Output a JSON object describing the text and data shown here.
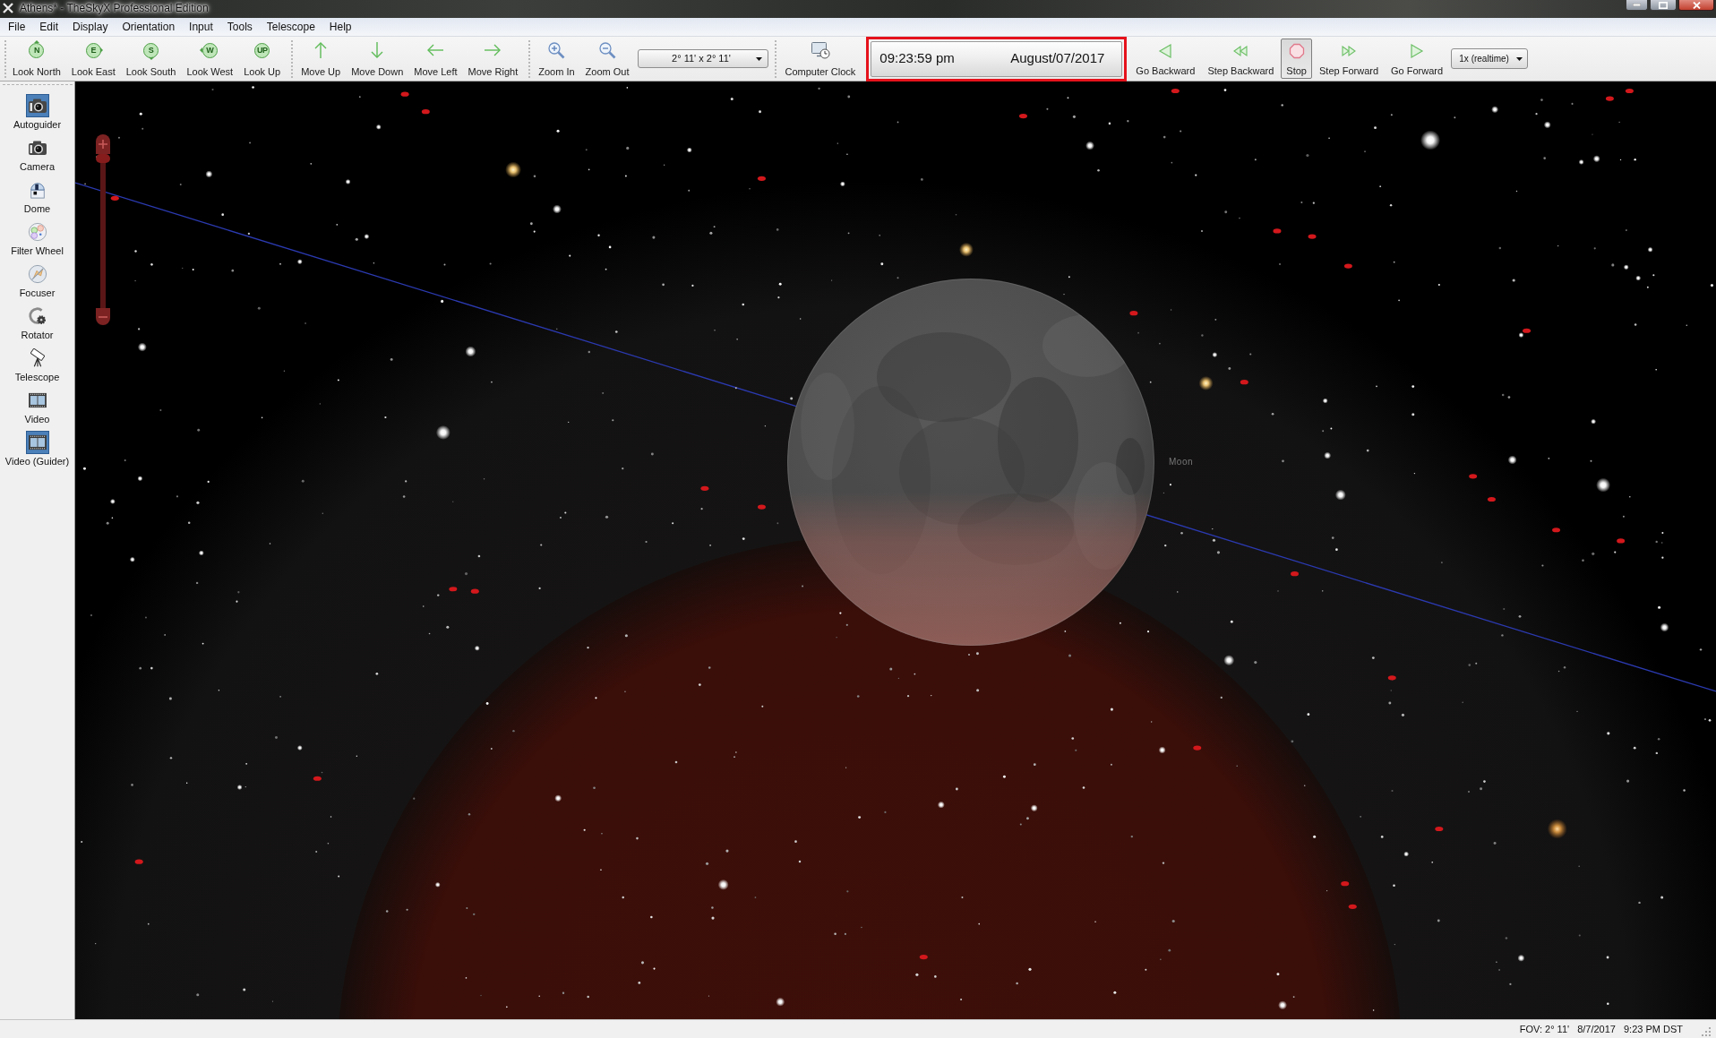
{
  "window": {
    "title": "Athens* - TheSkyX Professional Edition"
  },
  "menu_bar": [
    "File",
    "Edit",
    "Display",
    "Orientation",
    "Input",
    "Tools",
    "Telescope",
    "Help"
  ],
  "toolbar": {
    "look": [
      {
        "label": "Look North",
        "badge": "N",
        "kind": "north"
      },
      {
        "label": "Look East",
        "badge": "E",
        "kind": "east"
      },
      {
        "label": "Look South",
        "badge": "S",
        "kind": "south"
      },
      {
        "label": "Look West",
        "badge": "W",
        "kind": "west"
      },
      {
        "label": "Look Up",
        "badge": "UP",
        "kind": "up"
      }
    ],
    "move": [
      {
        "label": "Move Up",
        "kind": "up"
      },
      {
        "label": "Move Down",
        "kind": "down"
      },
      {
        "label": "Move Left",
        "kind": "left"
      },
      {
        "label": "Move Right",
        "kind": "right"
      }
    ],
    "zoom": [
      {
        "label": "Zoom In",
        "kind": "in"
      },
      {
        "label": "Zoom Out",
        "kind": "out"
      }
    ],
    "fov_dropdown": {
      "value": "2° 11' x 2° 11'"
    },
    "computer_clock": {
      "label": "Computer Clock"
    },
    "datetime": {
      "time": "09:23:59 pm",
      "date": "August/07/2017",
      "highlighted": true
    },
    "playback": [
      {
        "label": "Go Backward",
        "kind": "go-backward",
        "selected": false
      },
      {
        "label": "Step Backward",
        "kind": "step-backward",
        "selected": false
      },
      {
        "label": "Stop",
        "kind": "stop",
        "selected": true
      },
      {
        "label": "Step Forward",
        "kind": "step-forward",
        "selected": false
      },
      {
        "label": "Go Forward",
        "kind": "go-forward",
        "selected": false
      }
    ],
    "rate_dropdown": {
      "value": "1x (realtime)"
    }
  },
  "sidebar": {
    "items": [
      {
        "label": "Autoguider",
        "kind": "camera",
        "selected": true
      },
      {
        "label": "Camera",
        "kind": "camera",
        "selected": false
      },
      {
        "label": "Dome",
        "kind": "dome",
        "selected": false
      },
      {
        "label": "Filter Wheel",
        "kind": "filter-wheel",
        "selected": false
      },
      {
        "label": "Focuser",
        "kind": "focuser",
        "selected": false
      },
      {
        "label": "Rotator",
        "kind": "rotator",
        "selected": false
      },
      {
        "label": "Telescope",
        "kind": "telescope",
        "selected": false
      },
      {
        "label": "Video",
        "kind": "video",
        "selected": false
      },
      {
        "label": "Video (Guider)",
        "kind": "video",
        "selected": true
      }
    ]
  },
  "sky_view": {
    "zoom_slider": {
      "level": 1
    },
    "moon_label": "Moon"
  },
  "status_bar": [
    "FOV: 2° 11'",
    "8/7/2017",
    "9:23 PM DST"
  ]
}
